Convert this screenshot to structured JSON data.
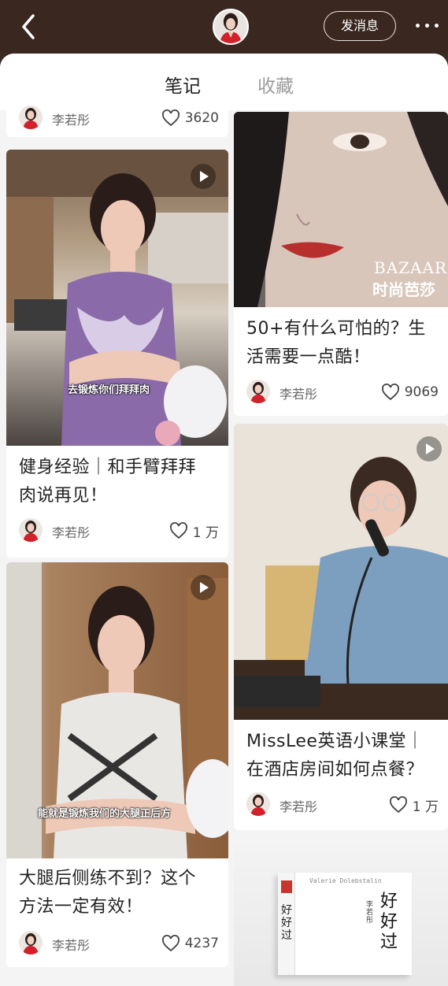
{
  "header": {
    "back_icon": "chevron-left-icon",
    "message_button": "发消息",
    "more_icon": "more-dots-icon"
  },
  "tabs": [
    {
      "label": "笔记",
      "active": true
    },
    {
      "label": "收藏",
      "active": false
    }
  ],
  "colors": {
    "accent": "#ff2442",
    "header_bg": "#3a2720"
  },
  "notes": [
    {
      "title": "",
      "author": "李若彤",
      "likes": "3620"
    },
    {
      "title": "50+有什么可怕的？生活需要一点酷！",
      "title_lines": [
        "50+有什么可怕的？生",
        "活需要一点酷！"
      ],
      "author": "李若彤",
      "likes": "9069",
      "cover_text_line1": "BAZAAR",
      "cover_text_line2": "时尚芭莎"
    },
    {
      "title_lines": [
        "健身经验｜和手臂拜拜",
        "肉说再见！"
      ],
      "author": "李若彤",
      "likes": "1 万",
      "video": true,
      "caption": "去锻炼你们拜拜肉"
    },
    {
      "title_lines": [
        "MissLee英语小课堂｜",
        "在酒店房间如何点餐？"
      ],
      "author": "李若彤",
      "likes": "1 万",
      "video": true
    },
    {
      "title_lines": [
        "大腿后侧练不到？这个",
        "方法一定有效！"
      ],
      "author": "李若彤",
      "likes": "4237",
      "video": true,
      "caption": "能就是锻炼我们的大腿正后方"
    },
    {
      "book_author_line": "Valerie Dolebstalin",
      "book_title": "好好过",
      "book_author": "李若彤",
      "book_title_side": "好好过"
    }
  ]
}
